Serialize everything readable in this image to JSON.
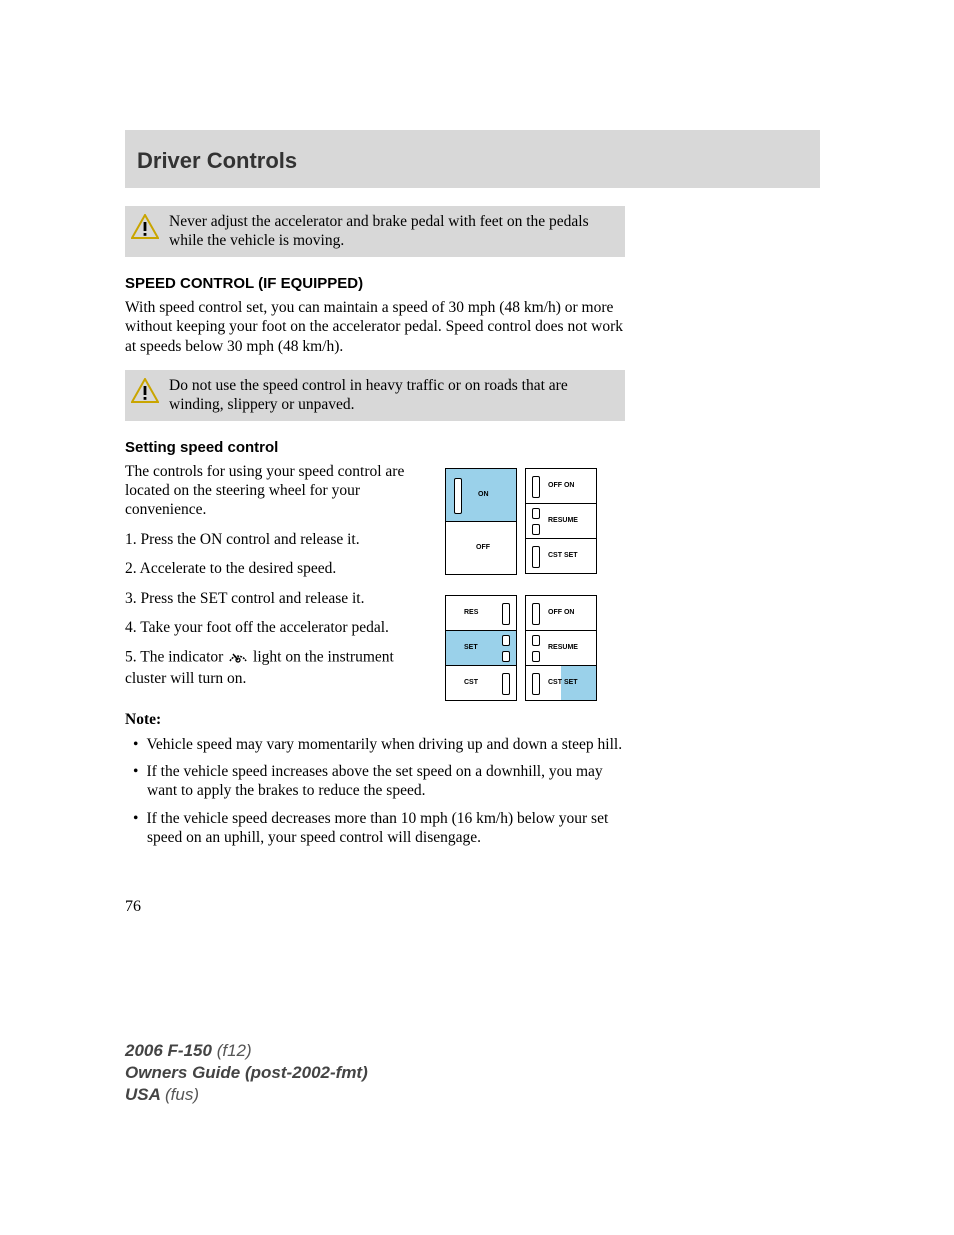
{
  "header": {
    "title": "Driver Controls"
  },
  "warn1": "Never adjust the accelerator and brake pedal with feet on the pedals while the vehicle is moving.",
  "section1": {
    "head": "SPEED CONTROL (IF EQUIPPED)",
    "intro": "With speed control set, you can maintain a speed of 30 mph (48 km/h) or more without keeping your foot on the accelerator pedal. Speed control does not work at speeds below 30 mph (48 km/h)."
  },
  "warn2": "Do not use the speed control in heavy traffic or on roads that are winding, slippery or unpaved.",
  "section2": {
    "head": "Setting speed control",
    "intro": "The controls for using your speed control are located on the steering wheel for your convenience.",
    "steps": {
      "s1": "1. Press the ON control and release it.",
      "s2": "2. Accelerate to the desired speed.",
      "s3": "3. Press the SET control and release it.",
      "s4": "4. Take your foot off the accelerator pedal.",
      "s5a": "5. The indicator ",
      "s5b": " light on the instrument cluster will turn on."
    }
  },
  "diagram": {
    "on": "ON",
    "off": "OFF",
    "off_on": "OFF ON",
    "resume": "RESUME",
    "cst_set": "CST SET",
    "res": "RES",
    "set": "SET",
    "cst": "CST"
  },
  "noteHead": "Note:",
  "notes": {
    "n1": "Vehicle speed may vary momentarily when driving up and down a steep hill.",
    "n2": "If the vehicle speed increases above the set speed on a downhill, you may want to apply the brakes to reduce the speed.",
    "n3": "If the vehicle speed decreases more than 10 mph (16 km/h) below your set speed on an uphill, your speed control will disengage."
  },
  "pageNum": "76",
  "footer": {
    "l1a": "2006 F-150 ",
    "l1b": "(f12)",
    "l2": "Owners Guide (post-2002-fmt)",
    "l3a": "USA ",
    "l3b": "(fus)"
  }
}
